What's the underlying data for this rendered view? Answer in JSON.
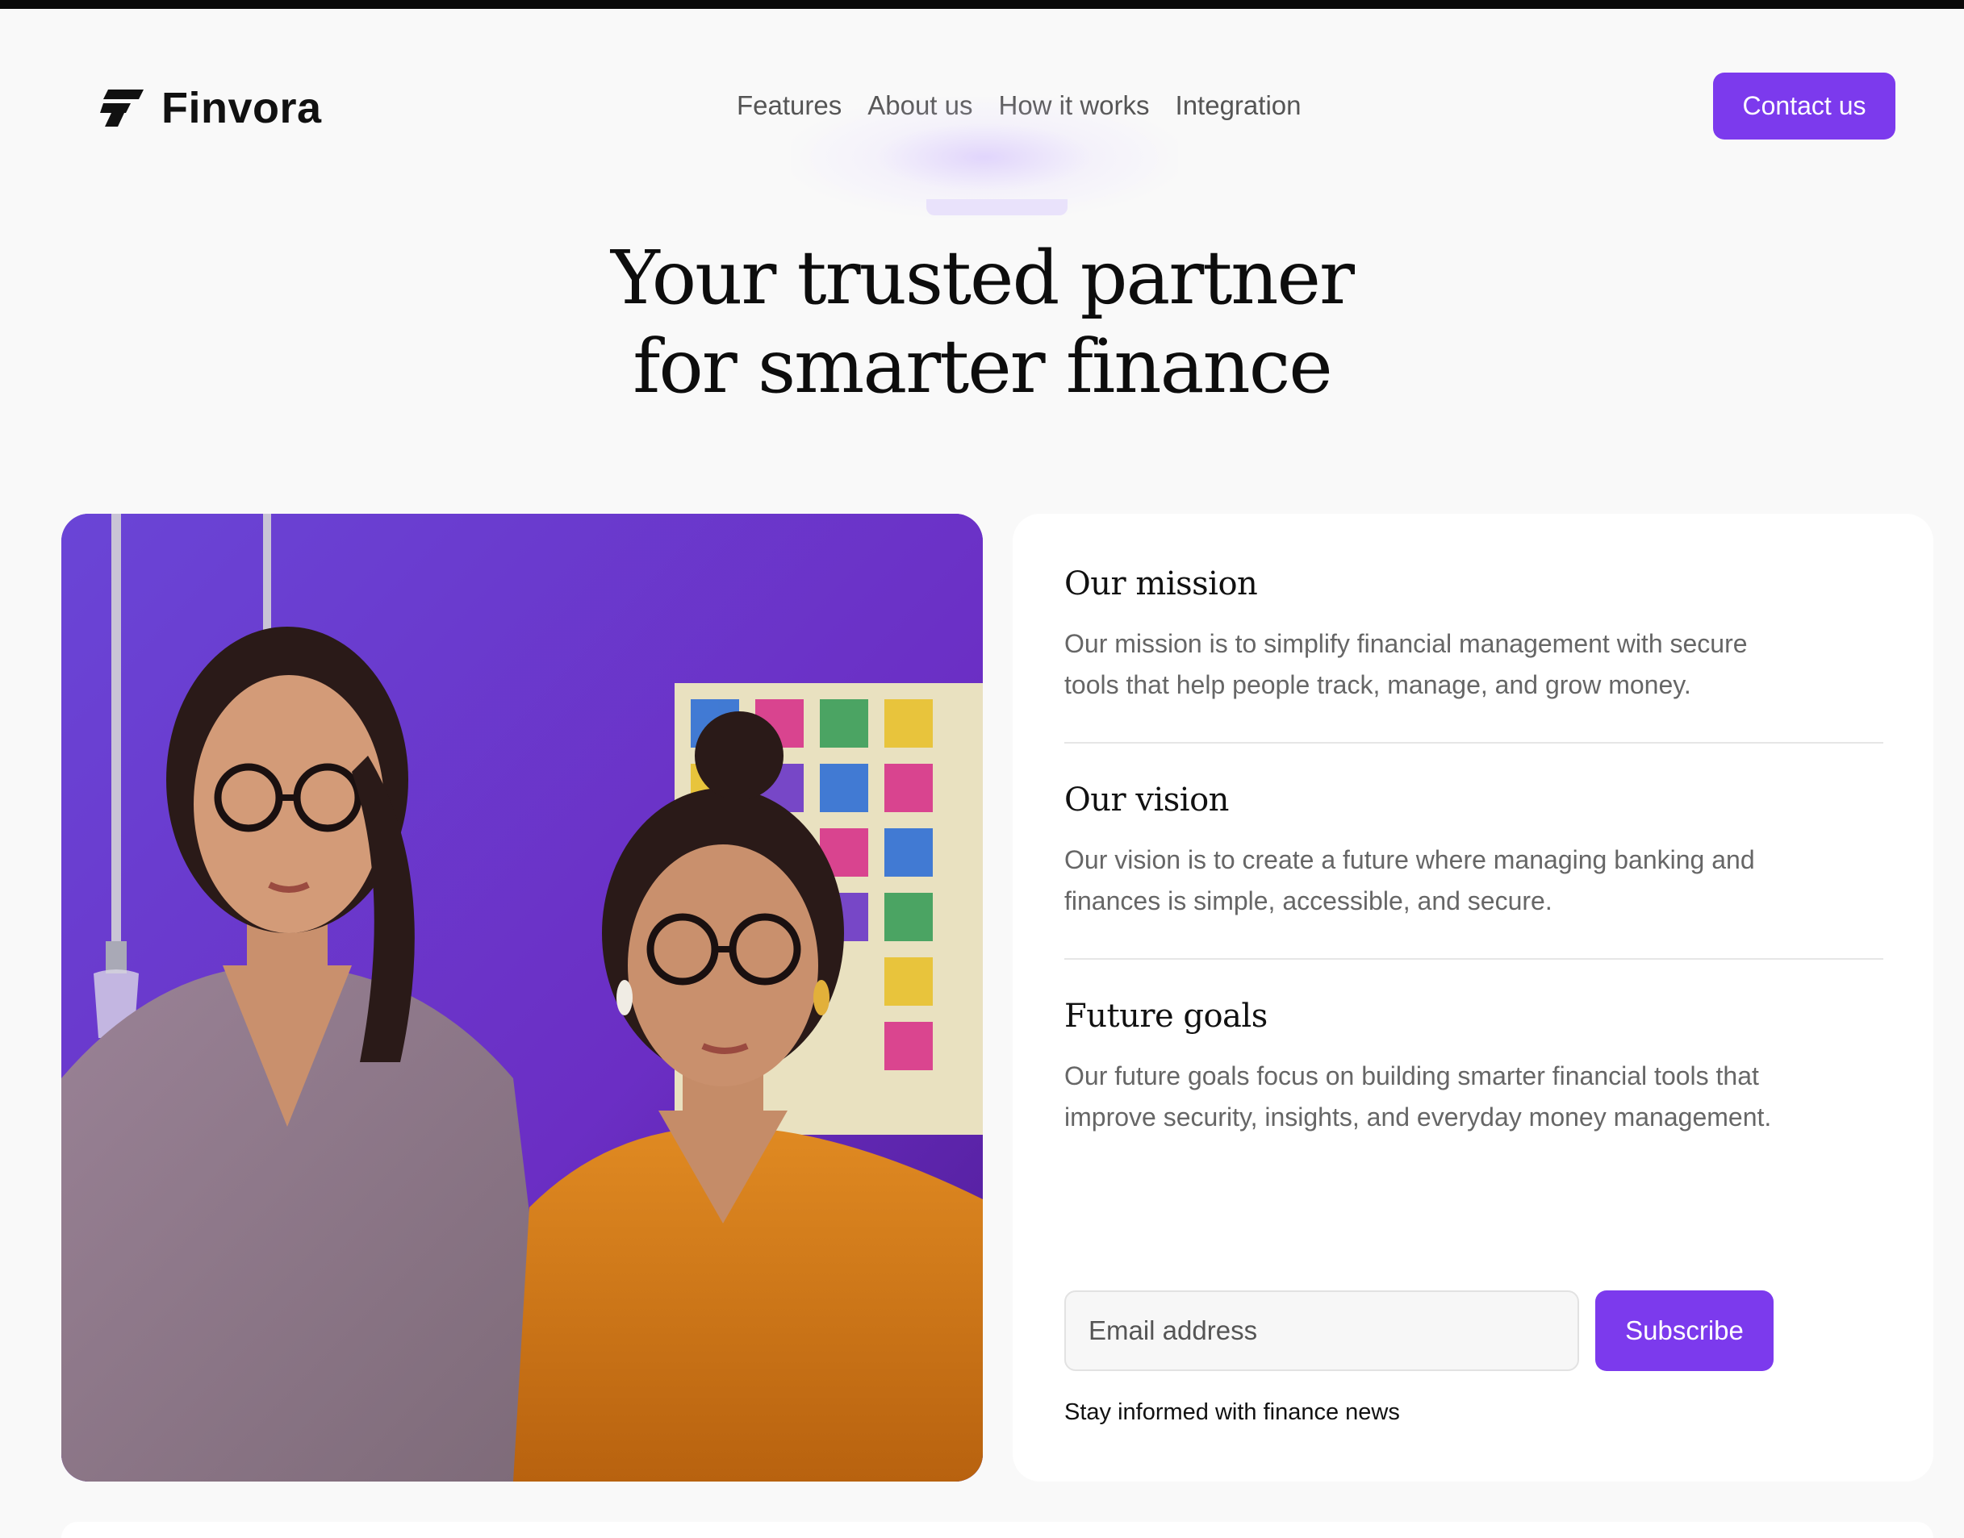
{
  "brand": {
    "name": "Finvora",
    "accent": "#7c3aed"
  },
  "nav": {
    "links": [
      "Features",
      "About us",
      "How it works",
      "Integration"
    ],
    "cta": "Contact us"
  },
  "hero": {
    "title_line1": "Your trusted partner",
    "title_line2": "for smarter finance"
  },
  "photo": {
    "icon": "photo-two-women-purple-wall"
  },
  "info": {
    "sections": [
      {
        "title": "Our mission",
        "body": "Our mission is to simplify financial management with secure tools that help people track, manage, and grow money."
      },
      {
        "title": "Our vision",
        "body": "Our vision is to create a future where managing banking and finances is simple, accessible, and secure."
      },
      {
        "title": "Future goals",
        "body": "Our future goals focus on building smarter financial tools that improve security, insights, and everyday money management."
      }
    ]
  },
  "newsletter": {
    "placeholder": "Email address",
    "button": "Subscribe",
    "helper": "Stay informed with finance news"
  }
}
